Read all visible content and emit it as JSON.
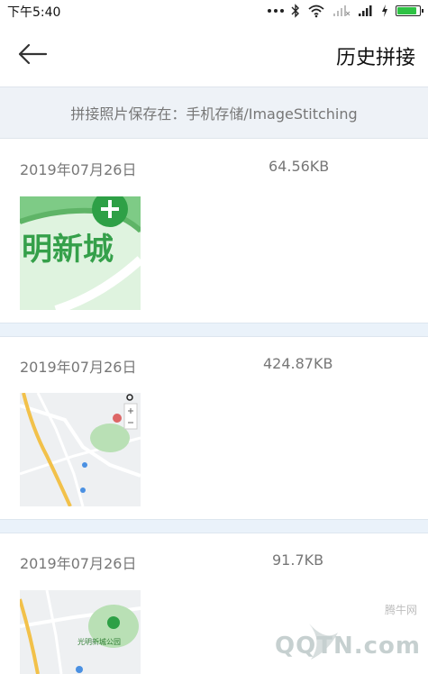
{
  "status_bar": {
    "time": "下午5:40",
    "battery_level_percent": 80,
    "icons": [
      "dots-icon",
      "bluetooth-icon",
      "wifi-icon",
      "signal-x-icon",
      "signal-icon",
      "charging-icon",
      "battery-icon"
    ]
  },
  "header": {
    "title": "历史拼接",
    "back_icon": "arrow-left-icon"
  },
  "info": {
    "text": "拼接照片保存在：手机存储/ImageStitching"
  },
  "records": [
    {
      "date": "2019年07月26日",
      "size": "64.56KB",
      "thumbnail_text": "明新城"
    },
    {
      "date": "2019年07月26日",
      "size": "424.87KB",
      "thumbnail_text": ""
    },
    {
      "date": "2019年07月26日",
      "size": "91.7KB",
      "thumbnail_text": "光明新城公园"
    }
  ],
  "watermark": {
    "top": "腾牛网",
    "main": "QQTN.com"
  },
  "colors": {
    "accent_green": "#2ec244",
    "banner_bg": "#eef2f7",
    "separator_bg": "#eaf2fa",
    "muted_text": "#777777"
  }
}
